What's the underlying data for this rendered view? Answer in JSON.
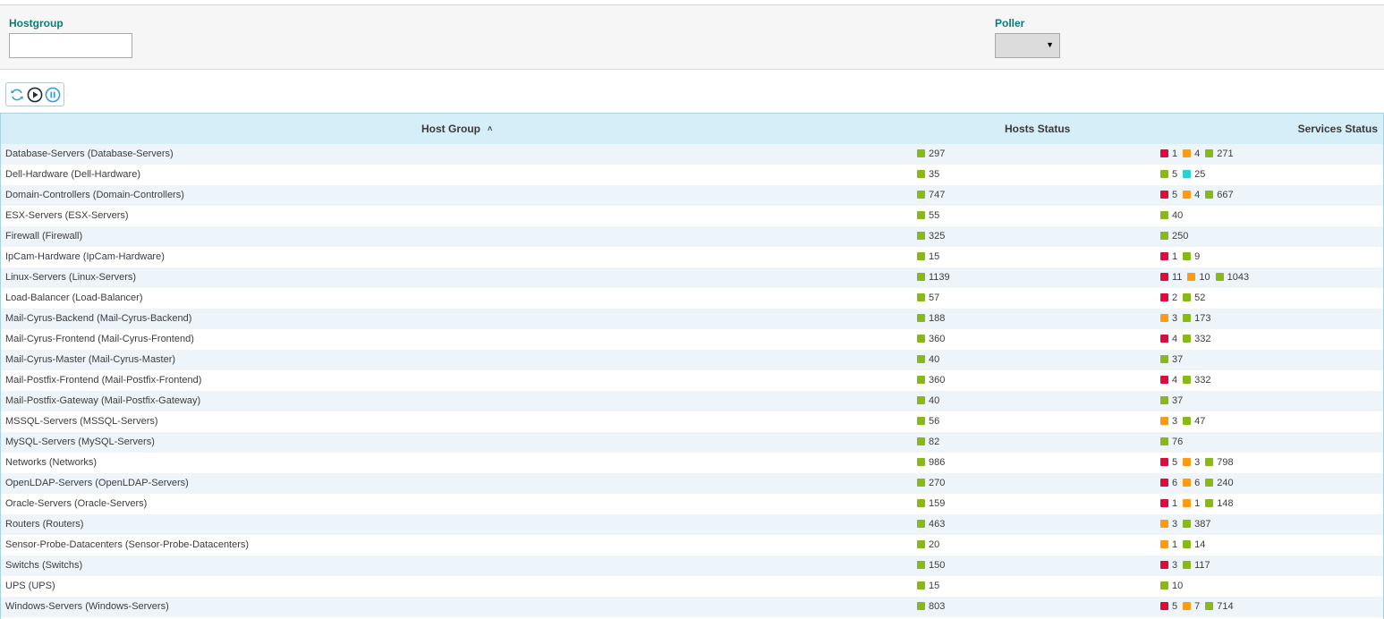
{
  "filters": {
    "hostgroup_label": "Hostgroup",
    "hostgroup_value": "",
    "poller_label": "Poller",
    "poller_selected": ""
  },
  "toolbar": {
    "refresh_icon": "refresh-icon",
    "play_icon": "play-icon",
    "pause_icon": "pause-icon"
  },
  "colors": {
    "ok": "#88b917",
    "critical": "#e00b3d",
    "warning": "#ff9a13",
    "pending": "#2ad1d4",
    "header_bg": "#d6eef8",
    "label_teal": "#0e7a75"
  },
  "table": {
    "columns": {
      "hostgroup": "Host Group",
      "hosts": "Hosts Status",
      "services": "Services Status"
    },
    "sort_icon": "sort-ascending-icon",
    "rows": [
      {
        "name": "Database-Servers (Database-Servers)",
        "hosts": [
          {
            "state": "green",
            "count": "297"
          }
        ],
        "services": [
          {
            "state": "red",
            "count": "1"
          },
          {
            "state": "orange",
            "count": "4"
          },
          {
            "state": "green",
            "count": "271"
          }
        ]
      },
      {
        "name": "Dell-Hardware (Dell-Hardware)",
        "hosts": [
          {
            "state": "green",
            "count": "35"
          }
        ],
        "services": [
          {
            "state": "green",
            "count": "5"
          },
          {
            "state": "cyan",
            "count": "25"
          }
        ]
      },
      {
        "name": "Domain-Controllers (Domain-Controllers)",
        "hosts": [
          {
            "state": "green",
            "count": "747"
          }
        ],
        "services": [
          {
            "state": "red",
            "count": "5"
          },
          {
            "state": "orange",
            "count": "4"
          },
          {
            "state": "green",
            "count": "667"
          }
        ]
      },
      {
        "name": "ESX-Servers (ESX-Servers)",
        "hosts": [
          {
            "state": "green",
            "count": "55"
          }
        ],
        "services": [
          {
            "state": "green",
            "count": "40"
          }
        ]
      },
      {
        "name": "Firewall (Firewall)",
        "hosts": [
          {
            "state": "green",
            "count": "325"
          }
        ],
        "services": [
          {
            "state": "green",
            "count": "250"
          }
        ]
      },
      {
        "name": "IpCam-Hardware (IpCam-Hardware)",
        "hosts": [
          {
            "state": "green",
            "count": "15"
          }
        ],
        "services": [
          {
            "state": "red",
            "count": "1"
          },
          {
            "state": "green",
            "count": "9"
          }
        ]
      },
      {
        "name": "Linux-Servers (Linux-Servers)",
        "hosts": [
          {
            "state": "green",
            "count": "1139"
          }
        ],
        "services": [
          {
            "state": "red",
            "count": "11"
          },
          {
            "state": "orange",
            "count": "10"
          },
          {
            "state": "green",
            "count": "1043"
          }
        ]
      },
      {
        "name": "Load-Balancer (Load-Balancer)",
        "hosts": [
          {
            "state": "green",
            "count": "57"
          }
        ],
        "services": [
          {
            "state": "red",
            "count": "2"
          },
          {
            "state": "green",
            "count": "52"
          }
        ]
      },
      {
        "name": "Mail-Cyrus-Backend (Mail-Cyrus-Backend)",
        "hosts": [
          {
            "state": "green",
            "count": "188"
          }
        ],
        "services": [
          {
            "state": "orange",
            "count": "3"
          },
          {
            "state": "green",
            "count": "173"
          }
        ]
      },
      {
        "name": "Mail-Cyrus-Frontend (Mail-Cyrus-Frontend)",
        "hosts": [
          {
            "state": "green",
            "count": "360"
          }
        ],
        "services": [
          {
            "state": "red",
            "count": "4"
          },
          {
            "state": "green",
            "count": "332"
          }
        ]
      },
      {
        "name": "Mail-Cyrus-Master (Mail-Cyrus-Master)",
        "hosts": [
          {
            "state": "green",
            "count": "40"
          }
        ],
        "services": [
          {
            "state": "green",
            "count": "37"
          }
        ]
      },
      {
        "name": "Mail-Postfix-Frontend (Mail-Postfix-Frontend)",
        "hosts": [
          {
            "state": "green",
            "count": "360"
          }
        ],
        "services": [
          {
            "state": "red",
            "count": "4"
          },
          {
            "state": "green",
            "count": "332"
          }
        ]
      },
      {
        "name": "Mail-Postfix-Gateway (Mail-Postfix-Gateway)",
        "hosts": [
          {
            "state": "green",
            "count": "40"
          }
        ],
        "services": [
          {
            "state": "green",
            "count": "37"
          }
        ]
      },
      {
        "name": "MSSQL-Servers (MSSQL-Servers)",
        "hosts": [
          {
            "state": "green",
            "count": "56"
          }
        ],
        "services": [
          {
            "state": "orange",
            "count": "3"
          },
          {
            "state": "green",
            "count": "47"
          }
        ]
      },
      {
        "name": "MySQL-Servers (MySQL-Servers)",
        "hosts": [
          {
            "state": "green",
            "count": "82"
          }
        ],
        "services": [
          {
            "state": "green",
            "count": "76"
          }
        ]
      },
      {
        "name": "Networks (Networks)",
        "hosts": [
          {
            "state": "green",
            "count": "986"
          }
        ],
        "services": [
          {
            "state": "red",
            "count": "5"
          },
          {
            "state": "orange",
            "count": "3"
          },
          {
            "state": "green",
            "count": "798"
          }
        ]
      },
      {
        "name": "OpenLDAP-Servers (OpenLDAP-Servers)",
        "hosts": [
          {
            "state": "green",
            "count": "270"
          }
        ],
        "services": [
          {
            "state": "red",
            "count": "6"
          },
          {
            "state": "orange",
            "count": "6"
          },
          {
            "state": "green",
            "count": "240"
          }
        ]
      },
      {
        "name": "Oracle-Servers (Oracle-Servers)",
        "hosts": [
          {
            "state": "green",
            "count": "159"
          }
        ],
        "services": [
          {
            "state": "red",
            "count": "1"
          },
          {
            "state": "orange",
            "count": "1"
          },
          {
            "state": "green",
            "count": "148"
          }
        ]
      },
      {
        "name": "Routers (Routers)",
        "hosts": [
          {
            "state": "green",
            "count": "463"
          }
        ],
        "services": [
          {
            "state": "orange",
            "count": "3"
          },
          {
            "state": "green",
            "count": "387"
          }
        ]
      },
      {
        "name": "Sensor-Probe-Datacenters (Sensor-Probe-Datacenters)",
        "hosts": [
          {
            "state": "green",
            "count": "20"
          }
        ],
        "services": [
          {
            "state": "orange",
            "count": "1"
          },
          {
            "state": "green",
            "count": "14"
          }
        ]
      },
      {
        "name": "Switchs (Switchs)",
        "hosts": [
          {
            "state": "green",
            "count": "150"
          }
        ],
        "services": [
          {
            "state": "red",
            "count": "3"
          },
          {
            "state": "green",
            "count": "117"
          }
        ]
      },
      {
        "name": "UPS (UPS)",
        "hosts": [
          {
            "state": "green",
            "count": "15"
          }
        ],
        "services": [
          {
            "state": "green",
            "count": "10"
          }
        ]
      },
      {
        "name": "Windows-Servers (Windows-Servers)",
        "hosts": [
          {
            "state": "green",
            "count": "803"
          }
        ],
        "services": [
          {
            "state": "red",
            "count": "5"
          },
          {
            "state": "orange",
            "count": "7"
          },
          {
            "state": "green",
            "count": "714"
          }
        ]
      }
    ]
  }
}
